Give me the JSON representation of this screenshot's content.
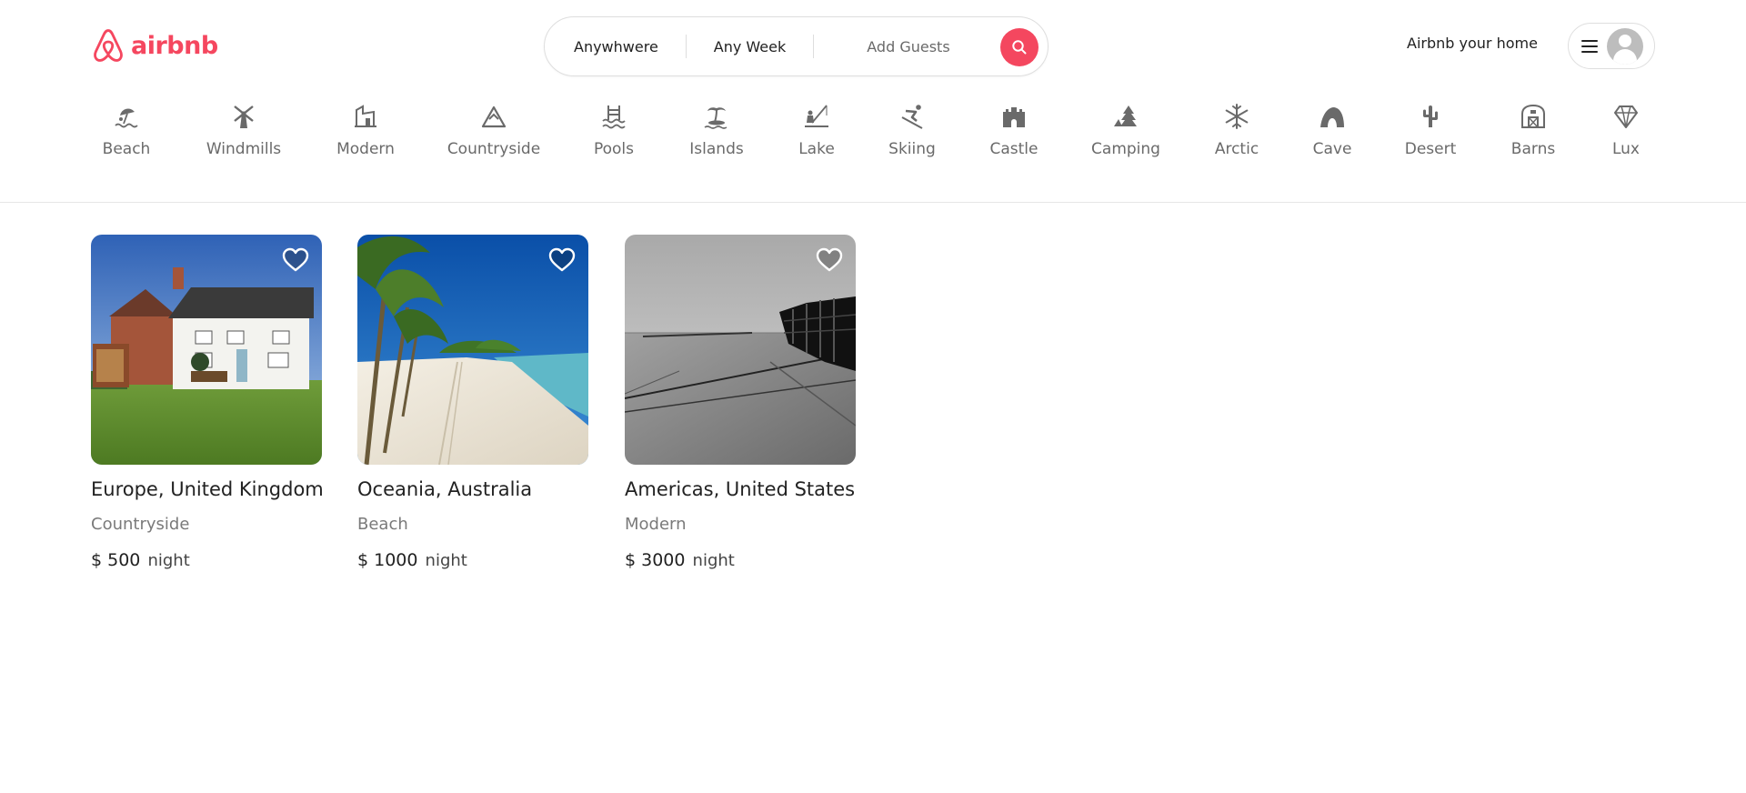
{
  "brand": {
    "name": "airbnb",
    "color": "#F5475F"
  },
  "search": {
    "where": "Anywhwere",
    "when": "Any Week",
    "guests": "Add Guests",
    "button_icon": "search-icon"
  },
  "header": {
    "host_link": "Airbnb your home",
    "menu_icon": "hamburger-icon",
    "avatar_icon": "avatar-icon"
  },
  "categories": [
    {
      "label": "Beach",
      "icon": "beach-umbrella-icon"
    },
    {
      "label": "Windmills",
      "icon": "windmill-icon"
    },
    {
      "label": "Modern",
      "icon": "modern-building-icon"
    },
    {
      "label": "Countryside",
      "icon": "mountain-icon"
    },
    {
      "label": "Pools",
      "icon": "pool-icon"
    },
    {
      "label": "Islands",
      "icon": "island-icon"
    },
    {
      "label": "Lake",
      "icon": "fishing-icon"
    },
    {
      "label": "Skiing",
      "icon": "skiing-icon"
    },
    {
      "label": "Castle",
      "icon": "castle-icon"
    },
    {
      "label": "Camping",
      "icon": "camping-icon"
    },
    {
      "label": "Arctic",
      "icon": "snowflake-icon"
    },
    {
      "label": "Cave",
      "icon": "cave-icon"
    },
    {
      "label": "Desert",
      "icon": "cactus-icon"
    },
    {
      "label": "Barns",
      "icon": "barn-icon"
    },
    {
      "label": "Lux",
      "icon": "diamond-icon"
    }
  ],
  "listings": [
    {
      "location": "Europe, United Kingdom",
      "category": "Countryside",
      "price": "$ 500",
      "unit": "night"
    },
    {
      "location": "Oceania, Australia",
      "category": "Beach",
      "price": "$ 1000",
      "unit": "night"
    },
    {
      "location": "Americas, United States",
      "category": "Modern",
      "price": "$ 3000",
      "unit": "night"
    }
  ]
}
